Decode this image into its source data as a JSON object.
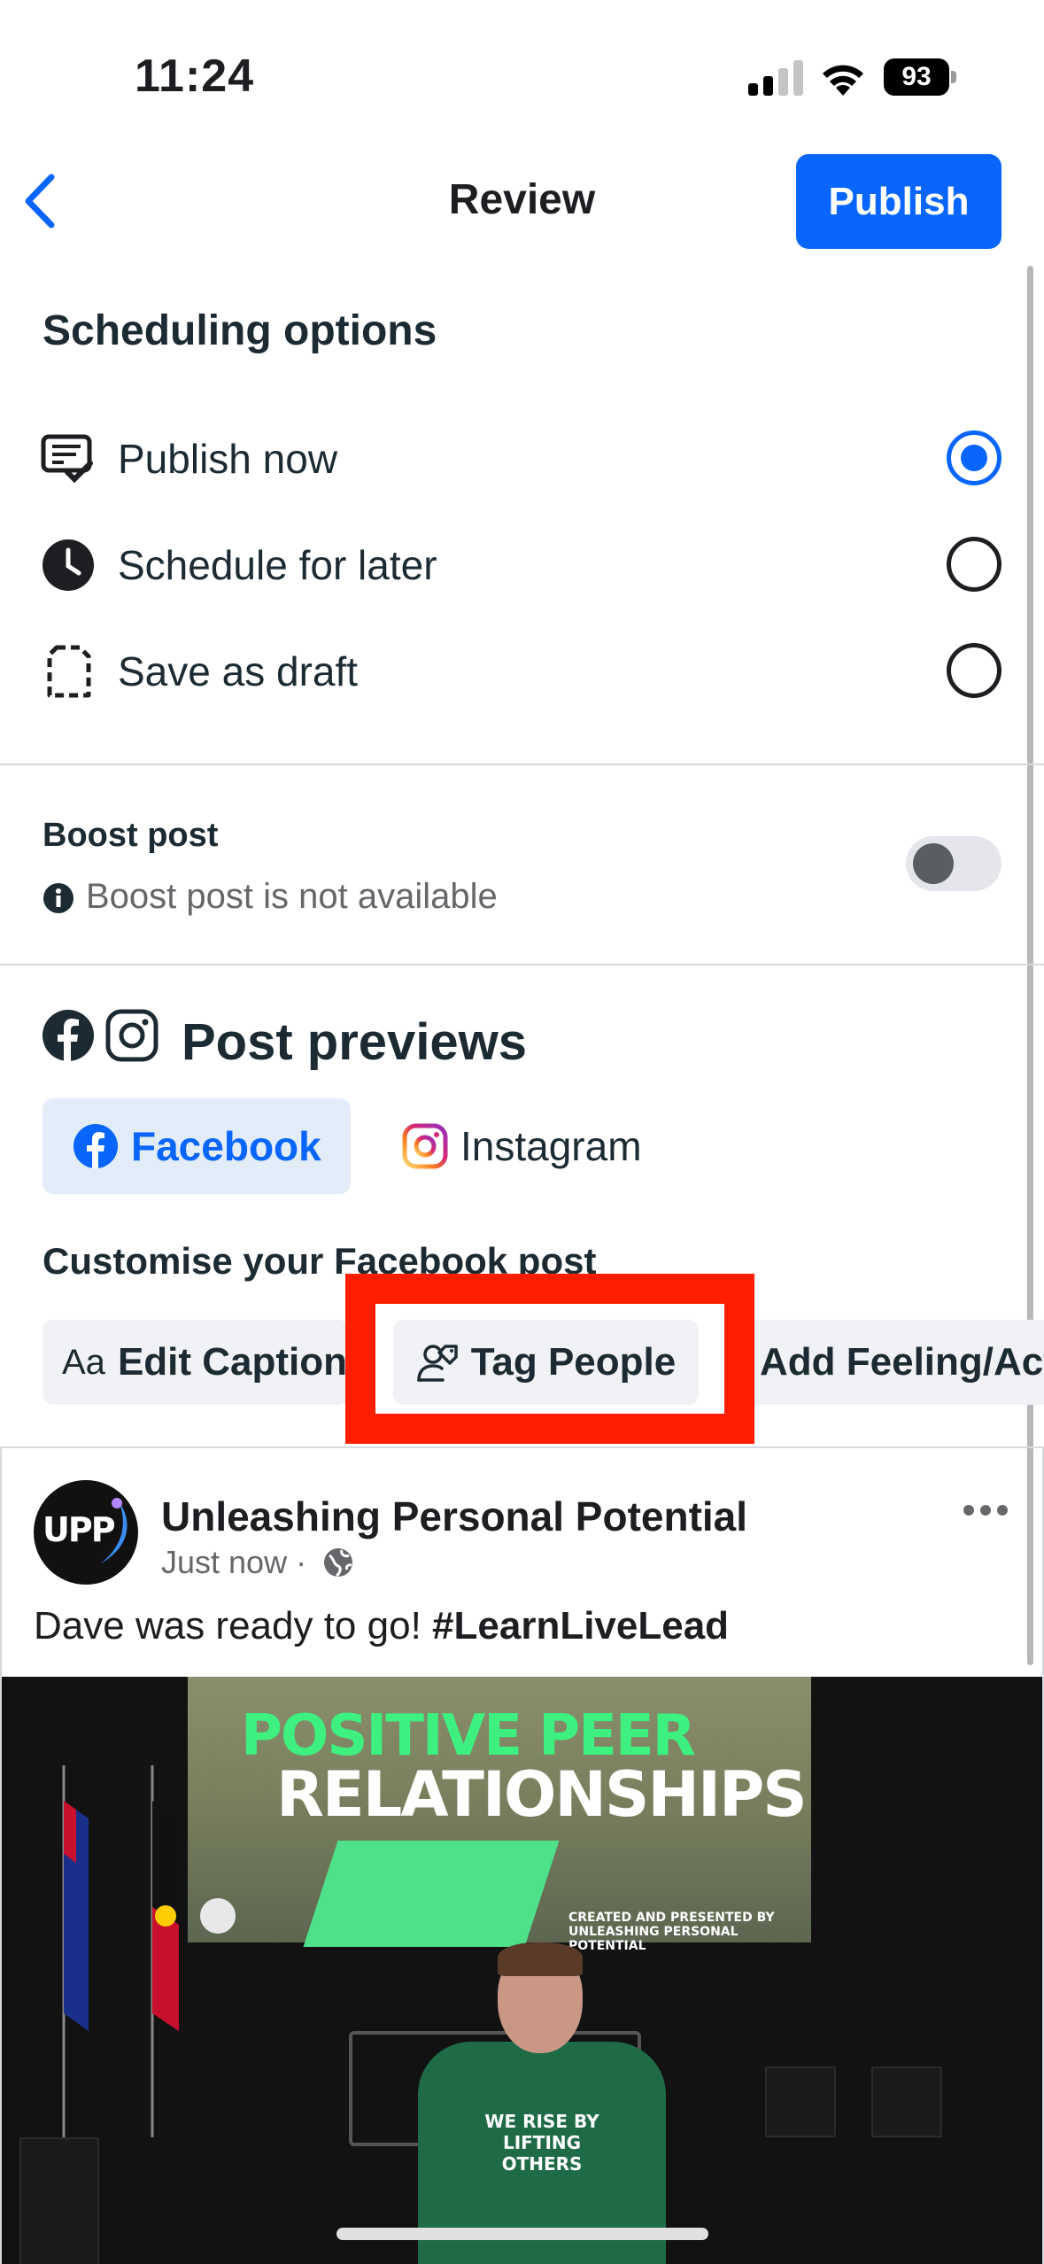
{
  "status_bar": {
    "time": "11:24",
    "battery": "93"
  },
  "header": {
    "title": "Review",
    "publish_label": "Publish"
  },
  "scheduling": {
    "title": "Scheduling options",
    "options": [
      {
        "label": "Publish now",
        "selected": true
      },
      {
        "label": "Schedule for later",
        "selected": false
      },
      {
        "label": "Save as draft",
        "selected": false
      }
    ]
  },
  "boost": {
    "title": "Boost post",
    "note": "Boost post is not available",
    "enabled": false
  },
  "previews": {
    "title": "Post previews",
    "tabs": [
      {
        "label": "Facebook",
        "active": true
      },
      {
        "label": "Instagram",
        "active": false
      }
    ],
    "customise_title": "Customise your Facebook post",
    "chips": {
      "caption_prefix": "Aa",
      "caption": "Edit Caption",
      "tag": "Tag People",
      "feeling": "Add Feeling/Activity"
    }
  },
  "post": {
    "page_name": "Unleashing Personal Potential",
    "time": "Just now",
    "separator": "·",
    "text": "Dave was ready to go!",
    "hashtag": "#LearnLiveLead",
    "avatar_text": "UPP",
    "image": {
      "line1": "POSITIVE PEER",
      "line2": "RELATIONSHIPS",
      "credit_line1": "CREATED AND PRESENTED BY",
      "credit_line2": "UNLEASHING PERSONAL POTENTIAL",
      "shirt_line1": "WE RISE BY",
      "shirt_line2": "LIFTING OTHERS"
    }
  },
  "colors": {
    "accent": "#0866ff",
    "highlight": "#ff1f00",
    "tab_active_bg": "#e3edf9"
  }
}
